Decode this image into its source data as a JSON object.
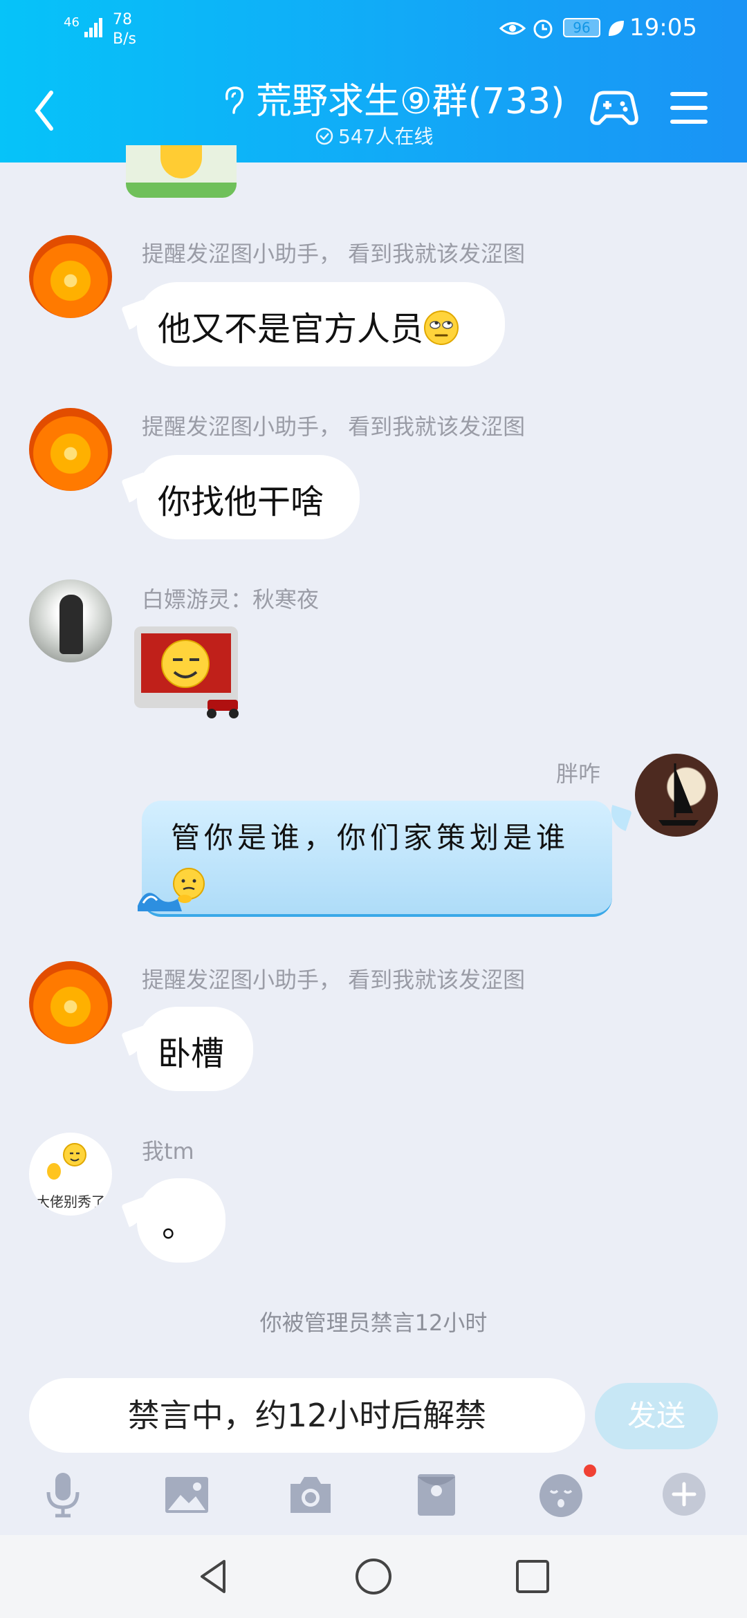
{
  "status_bar": {
    "network": "46",
    "speed_value": "78",
    "speed_unit": "B/s",
    "battery": "96",
    "time": "19:05"
  },
  "header": {
    "title": "荒野求生⑨群(733)",
    "online": "547人在线"
  },
  "messages": [
    {
      "sender": "提醒发涩图小助手，   看到我就该发涩图",
      "text": "他又不是官方人员"
    },
    {
      "sender": "提醒发涩图小助手，   看到我就该发涩图",
      "text": "你找他干啥"
    },
    {
      "sender": "白嫖游灵：秋寒夜",
      "text": ""
    },
    {
      "sender": "胖咋",
      "text": "管你是谁，你们家策划是谁"
    },
    {
      "sender": "提醒发涩图小助手，   看到我就该发涩图",
      "text": "卧槽"
    },
    {
      "sender": "我tm",
      "text": "。",
      "avatar_caption": "大佬别秀了"
    }
  ],
  "notice": "你被管理员禁言12小时",
  "input": {
    "placeholder": "禁言中，约12小时后解禁",
    "send_label": "发送"
  },
  "toolbar_icons": [
    "microphone-icon",
    "image-icon",
    "camera-icon",
    "red-packet-icon",
    "emoji-icon",
    "plus-icon"
  ],
  "colors": {
    "header_start": "#06c3f9",
    "header_end": "#1a93f5",
    "background": "#ebeef6",
    "sent_bubble": "#bfe6fb",
    "send_button": "#c7e7f5",
    "badge_red": "#f04134"
  }
}
